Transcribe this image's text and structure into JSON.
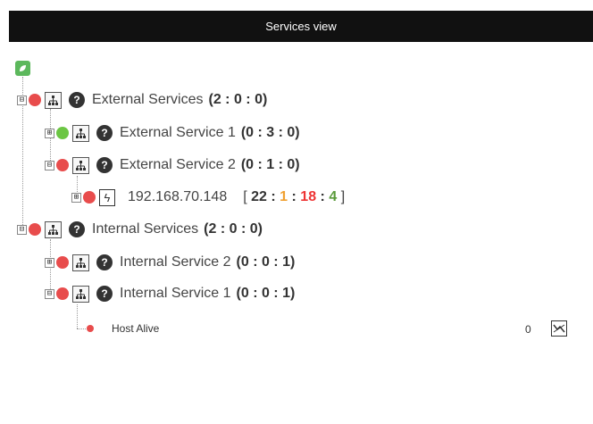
{
  "header": {
    "title": "Services view"
  },
  "tree": {
    "external_services": {
      "label": "External Services",
      "counts": "(2 : 0 : 0)"
    },
    "external_service_1": {
      "label": "External Service 1",
      "counts": "(0 : 3 : 0)"
    },
    "external_service_2": {
      "label": "External Service 2",
      "counts": "(0 : 1 : 0)"
    },
    "agent": {
      "label": "192.168.70.148",
      "open_bracket": "[",
      "close_bracket": "]",
      "sep": ":",
      "normal": "22",
      "warning": "1",
      "critical": "18",
      "ok": "4"
    },
    "internal_services": {
      "label": "Internal Services",
      "counts": "(2 : 0 : 0)"
    },
    "internal_service_2": {
      "label": "Internal Service 2",
      "counts": "(0 : 0 : 1)"
    },
    "internal_service_1": {
      "label": "Internal Service 1",
      "counts": "(0 : 0 : 1)"
    },
    "host_alive": {
      "label": "Host Alive",
      "value": "0"
    }
  },
  "icons": {
    "expander_collapse": "⊟",
    "expander_expand": "⊞",
    "help": "?",
    "bolt": "ϟ"
  },
  "colors": {
    "status_red": "#e84c4c",
    "status_green": "#6cc644",
    "warning": "#f0a030",
    "critical": "#e33",
    "ok": "#5a9a3a",
    "header_bg": "#111"
  }
}
